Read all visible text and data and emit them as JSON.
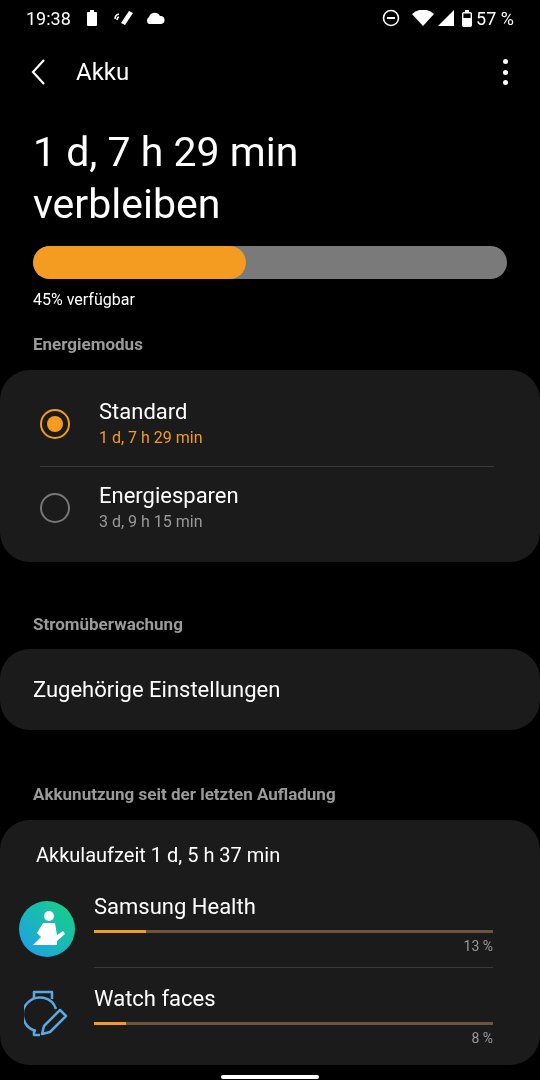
{
  "status_bar": {
    "time": "19:38",
    "battery": "57 %"
  },
  "header": {
    "title": "Akku"
  },
  "remaining": {
    "text": "1 d, 7 h 29 min verbleiben",
    "level": 0.45,
    "caption": "45% verfügbar"
  },
  "power_mode": {
    "heading": "Energiemodus",
    "options": [
      {
        "label": "Standard",
        "detail": "1 d, 7 h 29 min",
        "selected": true
      },
      {
        "label": "Energiesparen",
        "detail": "3 d, 9 h 15 min",
        "selected": false
      }
    ]
  },
  "monitoring": {
    "heading": "Stromüberwachung",
    "link": "Zugehörige Einstellungen"
  },
  "usage": {
    "heading": "Akkunutzung seit der letzten Aufladung",
    "runtime": "Akkulaufzeit 1 d, 5 h 37 min",
    "apps": [
      {
        "kind": "health",
        "name": "Samsung Health",
        "level": 0.13,
        "percent": "13 %"
      },
      {
        "kind": "watchface",
        "name": "Watch faces",
        "level": 0.08,
        "percent": "8 %"
      }
    ]
  }
}
